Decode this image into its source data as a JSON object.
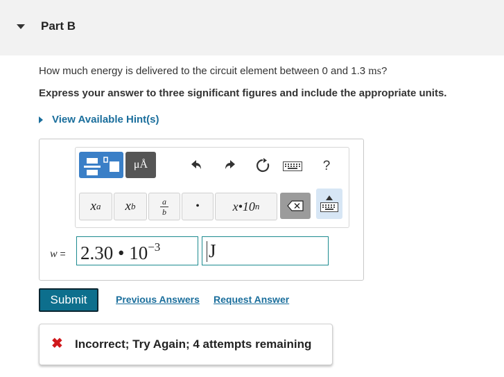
{
  "part": {
    "title": "Part B"
  },
  "question": {
    "text_before": "How much energy is delivered to the circuit element between 0 and 1.3 ",
    "unit": "ms",
    "text_after": "?",
    "instruction": "Express your answer to three significant figures and include the appropriate units."
  },
  "hint": {
    "label": "View Available Hint(s)"
  },
  "toolbar": {
    "units_label": "μÅ",
    "help_label": "?",
    "superscript": {
      "base": "x",
      "exp": "a"
    },
    "subscript": {
      "base": "x",
      "sub": "b"
    },
    "fraction": {
      "num": "a",
      "den": "b"
    },
    "dot_label": "•",
    "sci_notation": {
      "base": "x•10",
      "exp": "n"
    }
  },
  "answer": {
    "label_var": "w",
    "label_eq": " =",
    "mantissa": "2.30",
    "times": "•",
    "base": "10",
    "exponent": "−3",
    "units": "J"
  },
  "actions": {
    "submit": "Submit",
    "previous": "Previous Answers",
    "request": "Request Answer"
  },
  "feedback": {
    "icon": "✖",
    "text": "Incorrect; Try Again; 4 attempts remaining"
  },
  "colors": {
    "accent": "#1a6e9c",
    "submit": "#0d6f8d",
    "error": "#d0191c",
    "input_border": "#1b8a8f",
    "template_button": "#3a7fc7"
  }
}
